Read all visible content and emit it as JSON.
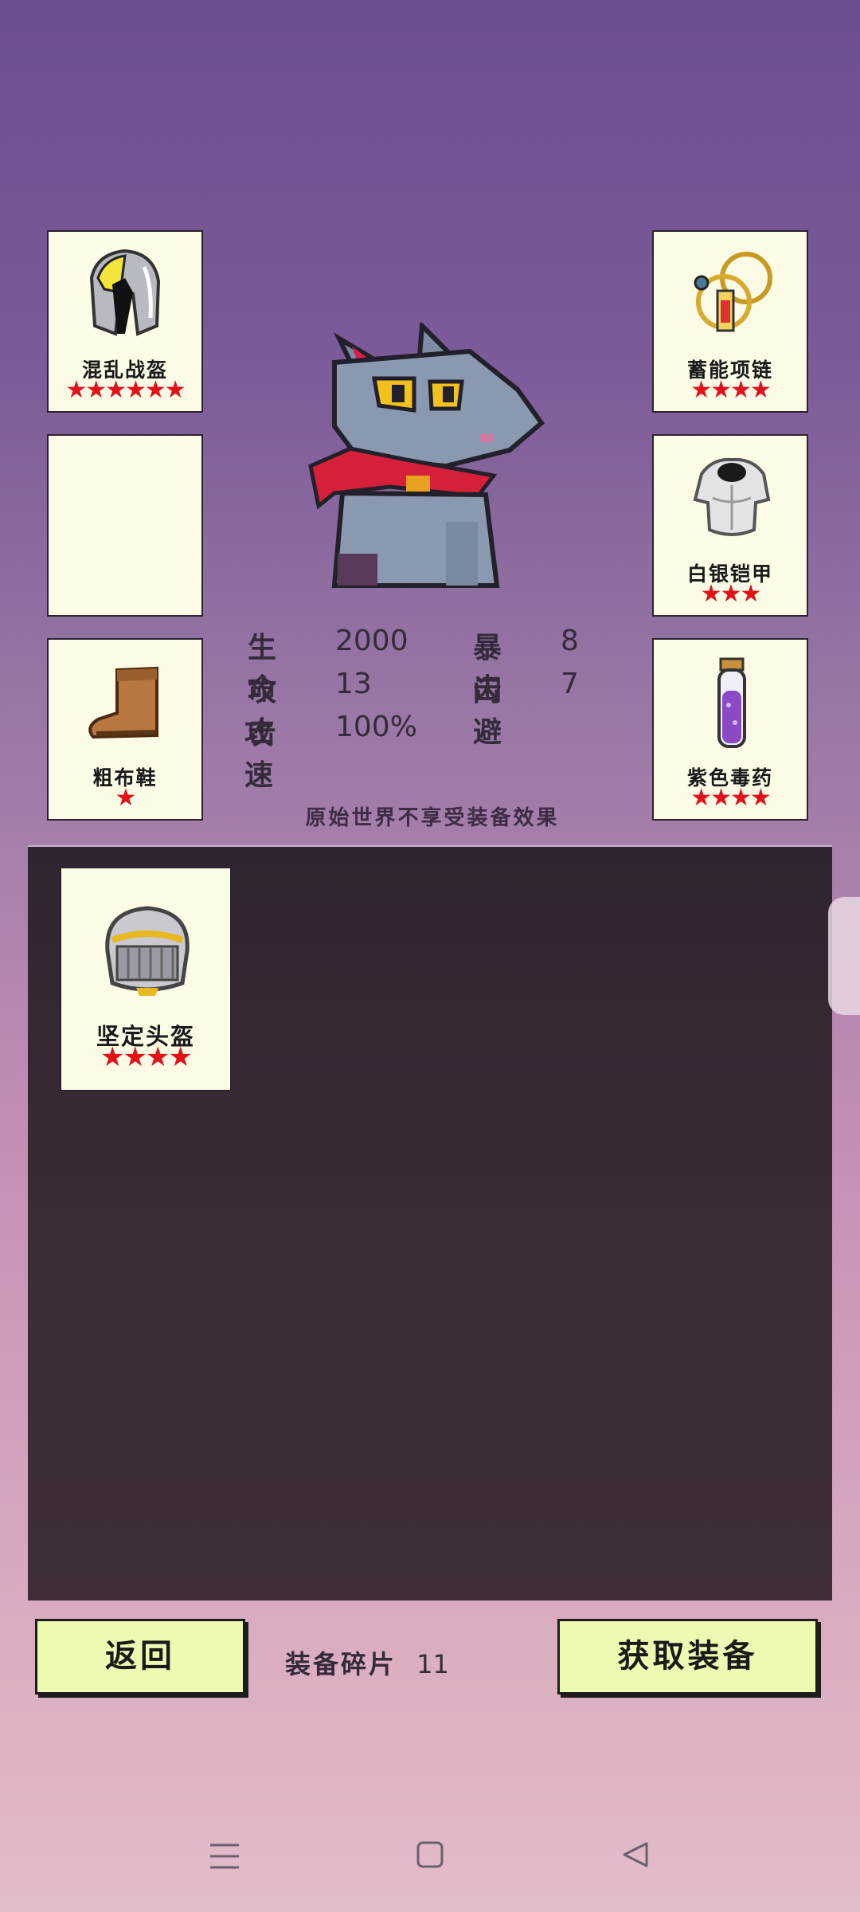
{
  "equipment": {
    "left": [
      {
        "name": "混乱战盔",
        "stars": "★★★★★★",
        "icon": "chaos-helmet-icon"
      },
      {
        "name": "",
        "stars": "",
        "icon": ""
      },
      {
        "name": "粗布鞋",
        "stars": "★",
        "icon": "cloth-boot-icon"
      }
    ],
    "right": [
      {
        "name": "蓄能项链",
        "stars": "★★★★",
        "icon": "energy-necklace-icon"
      },
      {
        "name": "白银铠甲",
        "stars": "★★★",
        "icon": "silver-armor-icon"
      },
      {
        "name": "紫色毒药",
        "stars": "★★★★",
        "icon": "purple-poison-icon"
      }
    ]
  },
  "stats": {
    "hp_label": "生命",
    "hp_value": "2000",
    "crit_label": "暴击",
    "crit_value": "8",
    "atk_label": "攻击",
    "atk_value": "13",
    "dodge_label": "闪避",
    "dodge_value": "7",
    "speed_label": "攻速",
    "speed_value": "100%"
  },
  "notice": "原始世界不享受装备效果",
  "inventory": [
    {
      "name": "坚定头盔",
      "stars": "★★★★",
      "icon": "steadfast-helmet-icon"
    }
  ],
  "footer": {
    "back_label": "返回",
    "fragments_label": "装备碎片",
    "fragments_value": "11",
    "get_equipment_label": "获取装备"
  },
  "colors": {
    "card_bg": "#fbfbe6",
    "star": "#e3101a",
    "button_bg": "#ecfbb1",
    "inventory_bg": "#3a2b36"
  },
  "system_nav": [
    "menu-icon",
    "home-icon",
    "back-icon"
  ]
}
